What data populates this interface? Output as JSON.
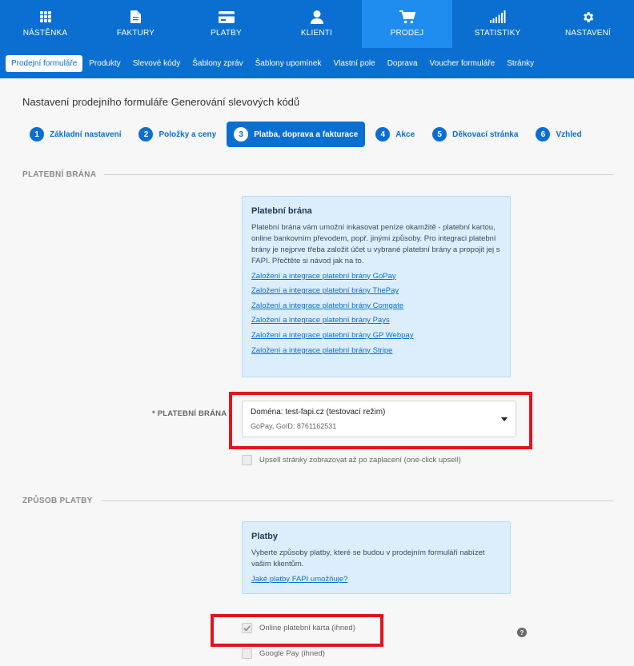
{
  "topnav": {
    "items": [
      {
        "label": "NÁSTĚNKA",
        "icon": "dashboard-grid-icon"
      },
      {
        "label": "FAKTURY",
        "icon": "document-icon"
      },
      {
        "label": "PLATBY",
        "icon": "credit-card-icon"
      },
      {
        "label": "KLIENTI",
        "icon": "user-icon"
      },
      {
        "label": "PRODEJ",
        "icon": "shopping-cart-icon",
        "active": true
      },
      {
        "label": "STATISTIKY",
        "icon": "signal-bars-icon"
      },
      {
        "label": "NASTAVENÍ",
        "icon": "gear-icon"
      }
    ]
  },
  "subnav": {
    "items": [
      "Prodejní formuláře",
      "Produkty",
      "Slevové kódy",
      "Šablony zpráv",
      "Šablony upomínek",
      "Vlastní pole",
      "Doprava",
      "Voucher formuláře",
      "Stránky"
    ],
    "active_index": 0
  },
  "page": {
    "title": "Nastavení prodejního formuláře Generování slevových kódů"
  },
  "steps": [
    {
      "num": "1",
      "label": "Základní nastavení"
    },
    {
      "num": "2",
      "label": "Položky a ceny"
    },
    {
      "num": "3",
      "label": "Platba, doprava a fakturace",
      "active": true
    },
    {
      "num": "4",
      "label": "Akce"
    },
    {
      "num": "5",
      "label": "Děkovací stránka"
    },
    {
      "num": "6",
      "label": "Vzhled"
    }
  ],
  "gateway_section": {
    "title": "PLATEBNÍ BRÁNA",
    "info": {
      "heading": "Platební brána",
      "text": "Platební brána vám umožní inkasovat peníze okamžitě - platební kartou, online bankovním převodem, popř. jinými způsoby. Pro integraci platební brány je nejprve třeba založit účet u vybrané platební brány a propojit jej s FAPI. Přečtěte si návod jak na to.",
      "links": [
        "Založení a integrace platební brány GoPay",
        "Založení a integrace platební brány ThePay",
        "Založení a integrace platební brány Comgate",
        "Založení a integrace platební brány Pays",
        "Založení a integrace platební brány GP Webpay",
        "Založení a integrace platební brány Stripe"
      ]
    },
    "field_label": "* PLATEBNÍ BRÁNA",
    "select": {
      "line1": "Doména: test-fapi.cz (testovací režim)",
      "line2": "GoPay, GoID: 8761162531"
    },
    "upsell_label": "Upsell stránky zobrazovat až po zaplacení (one-click upsell)",
    "upsell_checked": false
  },
  "payment_section": {
    "title": "ZPŮSOB PLATBY",
    "info": {
      "heading": "Platby",
      "text": "Vyberte způsoby platby, které se budou v prodejním formuláři nabízet vašim klientům.",
      "link": "Jaké platby FAPI umožňuje?"
    },
    "options": [
      {
        "label": "Online platební karta (ihned)",
        "checked": true
      },
      {
        "label": "Google Pay (ihned)",
        "checked": false
      }
    ],
    "help_glyph": "?"
  },
  "colors": {
    "brand_blue": "#0a6fd1",
    "active_tab_blue": "#1f8df0",
    "highlight_red": "#e3141b",
    "info_bg": "#dceefc"
  }
}
